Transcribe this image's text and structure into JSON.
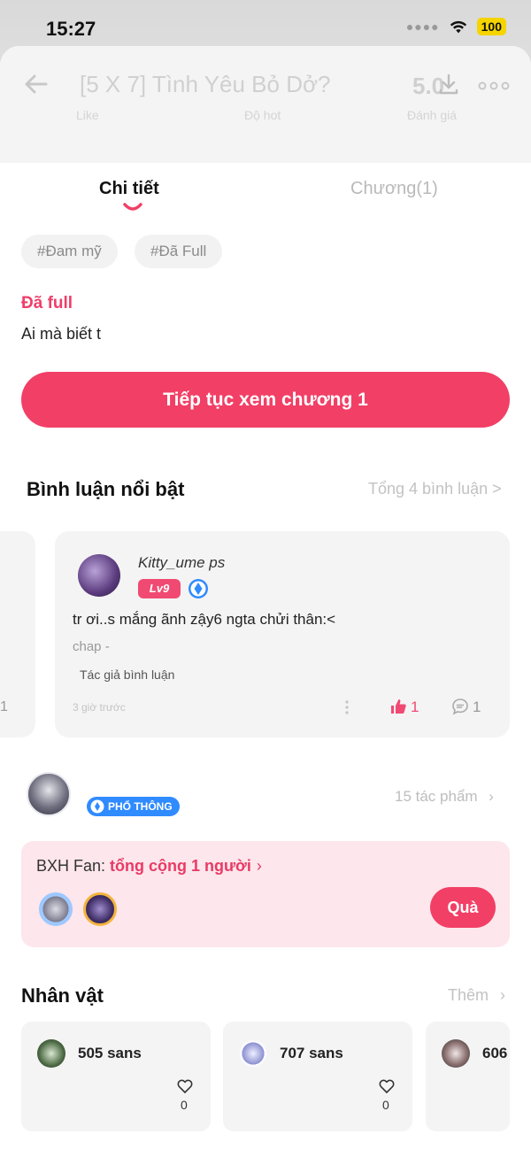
{
  "status_bar": {
    "time": "15:27",
    "battery": "100"
  },
  "header": {
    "title": "[5 X 7] Tình Yêu Bỏ Dở?",
    "score": "5.0",
    "stat_labels": [
      "Like",
      "Độ hot",
      "Đánh giá"
    ]
  },
  "tabs": [
    {
      "label": "Chi tiết",
      "active": true
    },
    {
      "label": "Chương(1)",
      "active": false
    }
  ],
  "tags": [
    "#Đam mỹ",
    "#Đã Full"
  ],
  "story": {
    "status": "Đã full",
    "description": "Ai mà biết t",
    "continue_label": "Tiếp tục xem chương 1"
  },
  "comments": {
    "title": "Bình luận nổi bật",
    "total_link": "Tổng 4 bình luận >",
    "prev_card_count": "1",
    "featured": {
      "username": "Kitty_ume ps",
      "level": "Lv9",
      "text": "tr ơi..s mắng ãnh zậy6 ngta chửi thân:<",
      "chapter": "chap -",
      "author_tag": "Tác giả bình luận",
      "time": "3 giờ trước",
      "likes": "1",
      "replies": "1"
    }
  },
  "author": {
    "rank": "PHỔ THÔNG",
    "works_link": "15 tác phẩm"
  },
  "fan_rank": {
    "label_prefix": "BXH Fan: ",
    "label_highlight": "tổng cộng 1 người",
    "gift_label": "Quà"
  },
  "characters": {
    "title": "Nhân vật",
    "more_link": "Thêm",
    "items": [
      {
        "name": "505 sans",
        "likes": "0"
      },
      {
        "name": "707 sans",
        "likes": "0"
      },
      {
        "name": "606",
        "likes": ""
      }
    ]
  },
  "colors": {
    "accent": "#f23f66",
    "accent_text": "#e83b66",
    "badge_blue": "#2f8bff"
  }
}
